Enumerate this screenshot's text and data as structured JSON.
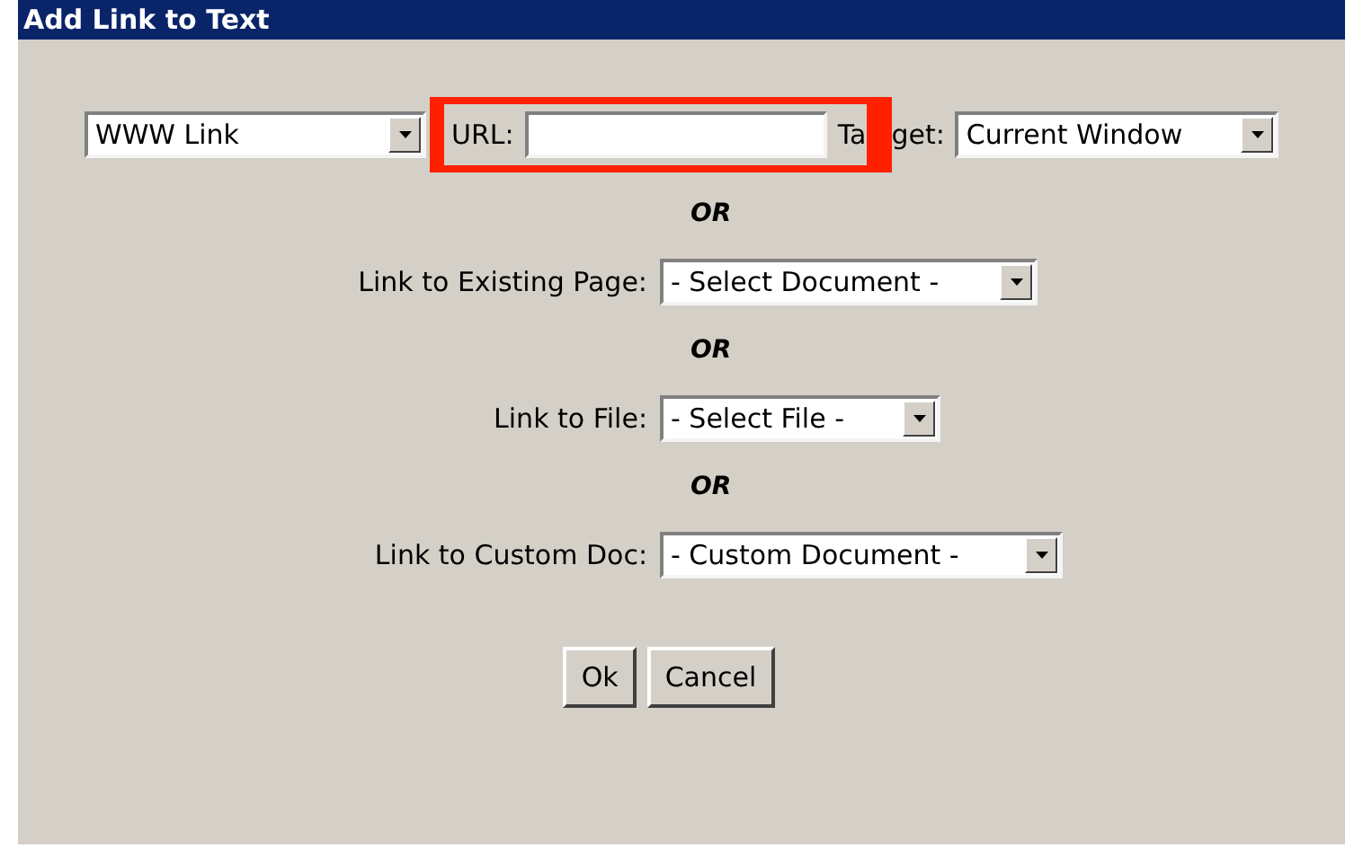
{
  "window": {
    "title": "Add Link to Text"
  },
  "link_type": {
    "value": "WWW Link"
  },
  "url": {
    "label": "URL:",
    "highlighted": true
  },
  "target": {
    "label_parts": [
      "Ta",
      "get:"
    ],
    "value": "Current Window"
  },
  "alternatives": [
    {
      "kind": "separator",
      "text": "OR"
    },
    {
      "kind": "select",
      "label": "Link to Existing Page:",
      "value": "- Select Document -"
    },
    {
      "kind": "separator",
      "text": "OR"
    },
    {
      "kind": "select",
      "label": "Link to File:",
      "value": "- Select File -"
    },
    {
      "kind": "separator",
      "text": "OR"
    },
    {
      "kind": "select",
      "label": "Link to Custom Doc:",
      "value": "- Custom Document -"
    }
  ],
  "buttons": [
    "Ok",
    "Cancel"
  ]
}
